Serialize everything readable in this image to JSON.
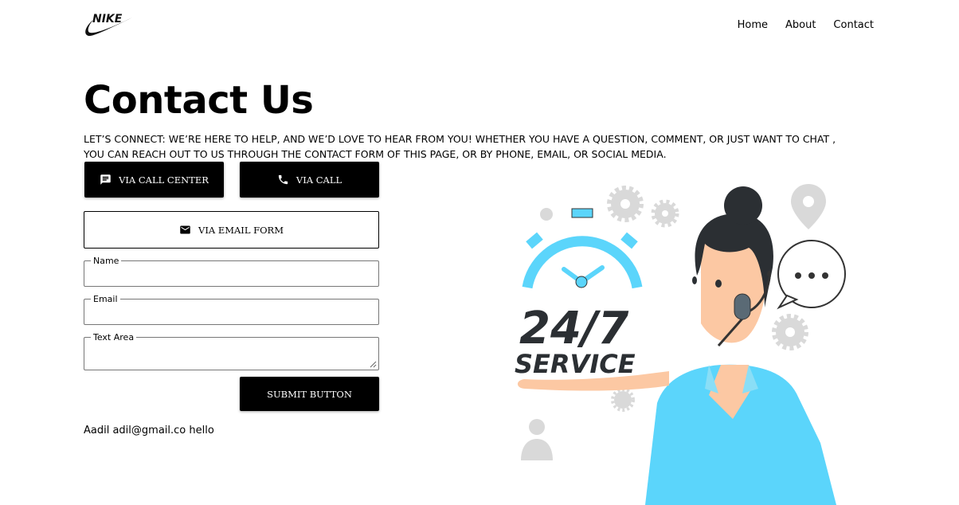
{
  "brand": {
    "logo": "NIKE"
  },
  "nav": {
    "items": [
      "Home",
      "About",
      "Contact"
    ]
  },
  "page": {
    "title": "Contact Us",
    "description": "Let’s connect: We’re here to help, and we’d love to hear from you! Whether you have a question, comment, or just want to chat , you can reach out to us through the contact form of this page, or by phone, email, or social media."
  },
  "buttons": {
    "call_center": "VIA CALL CENTER",
    "call": "VIA CALL",
    "email_form": "VIA EMAIL FORM",
    "submit": "SUBMIT BUTTON"
  },
  "form": {
    "name_label": "Name",
    "email_label": "Email",
    "text_label": "Text Area"
  },
  "result": {
    "text": "Aadil adil@gmail.co hello"
  },
  "illustration": {
    "line1": "24/7",
    "line2": "SERVICE"
  },
  "colors": {
    "primary": "#000000",
    "accent": "#5bd5fb",
    "gear": "#d9d9d9"
  },
  "icons": [
    "chat-icon",
    "phone-icon",
    "mail-icon"
  ]
}
